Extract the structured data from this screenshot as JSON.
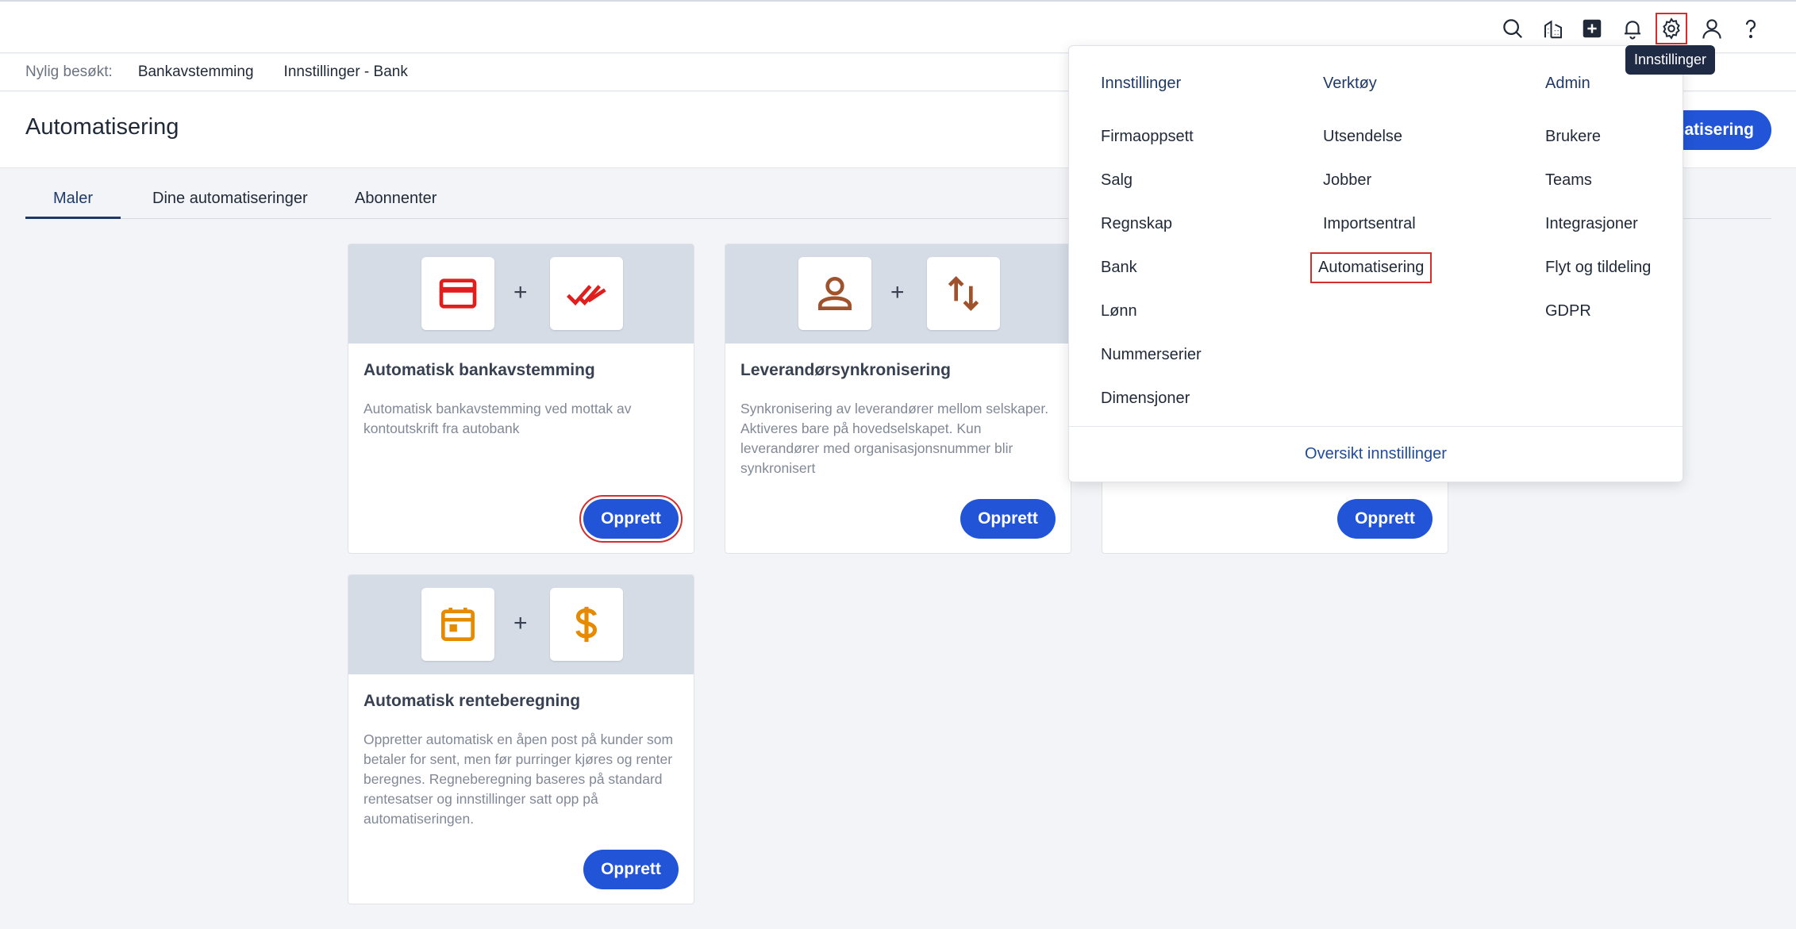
{
  "topbar": {
    "icons": [
      "search-icon",
      "buildings-icon",
      "add-square-icon",
      "bell-icon",
      "gear-icon",
      "user-icon",
      "help-icon"
    ],
    "tooltip": "Innstillinger"
  },
  "recent": {
    "label": "Nylig besøkt:",
    "links": [
      "Bankavstemming",
      "Innstillinger - Bank"
    ]
  },
  "header": {
    "title": "Automatisering",
    "new_button": "Ny automatisering"
  },
  "tabs": [
    "Maler",
    "Dine automatiseringer",
    "Abonnenter"
  ],
  "cards": [
    {
      "title": "Automatisk bankavstemming",
      "desc": "Automatisk bankavstemming ved mottak av kontoutskrift fra autobank",
      "button": "Opprett",
      "icons": [
        "credit-card-icon",
        "double-check-icon"
      ]
    },
    {
      "title": "Leverandørsynkronisering",
      "desc": "Synkronisering av leverandører mellom selskaper. Aktiveres bare på hovedselskapet. Kun leverandører med organisasjonsnummer blir synkronisert",
      "button": "Opprett",
      "icons": [
        "person-icon",
        "swap-arrows-icon"
      ]
    },
    {
      "button": "Opprett"
    },
    {
      "title": "Automatisk renteberegning",
      "desc": "Oppretter automatisk en åpen post på kunder som betaler for sent, men før purringer kjøres og renter beregnes. Regneberegning baseres på standard rentesatser og innstillinger satt opp på automatiseringen.",
      "button": "Opprett",
      "icons": [
        "calendar-icon",
        "dollar-icon"
      ]
    }
  ],
  "dropdown": {
    "columns": [
      {
        "heading": "Innstillinger",
        "items": [
          "Firmaoppsett",
          "Salg",
          "Regnskap",
          "Bank",
          "Lønn",
          "Nummerserier",
          "Dimensjoner"
        ]
      },
      {
        "heading": "Verktøy",
        "items": [
          "Utsendelse",
          "Jobber",
          "Importsentral",
          "Automatisering"
        ]
      },
      {
        "heading": "Admin",
        "items": [
          "Brukere",
          "Teams",
          "Integrasjoner",
          "Flyt og tildeling",
          "GDPR"
        ]
      }
    ],
    "footer": "Oversikt innstillinger"
  },
  "colors": {
    "primary": "#2154d6",
    "highlight": "#d32f2f",
    "card_red": "#e01e1e",
    "card_brown": "#a0522d",
    "card_orange": "#e68a00"
  }
}
